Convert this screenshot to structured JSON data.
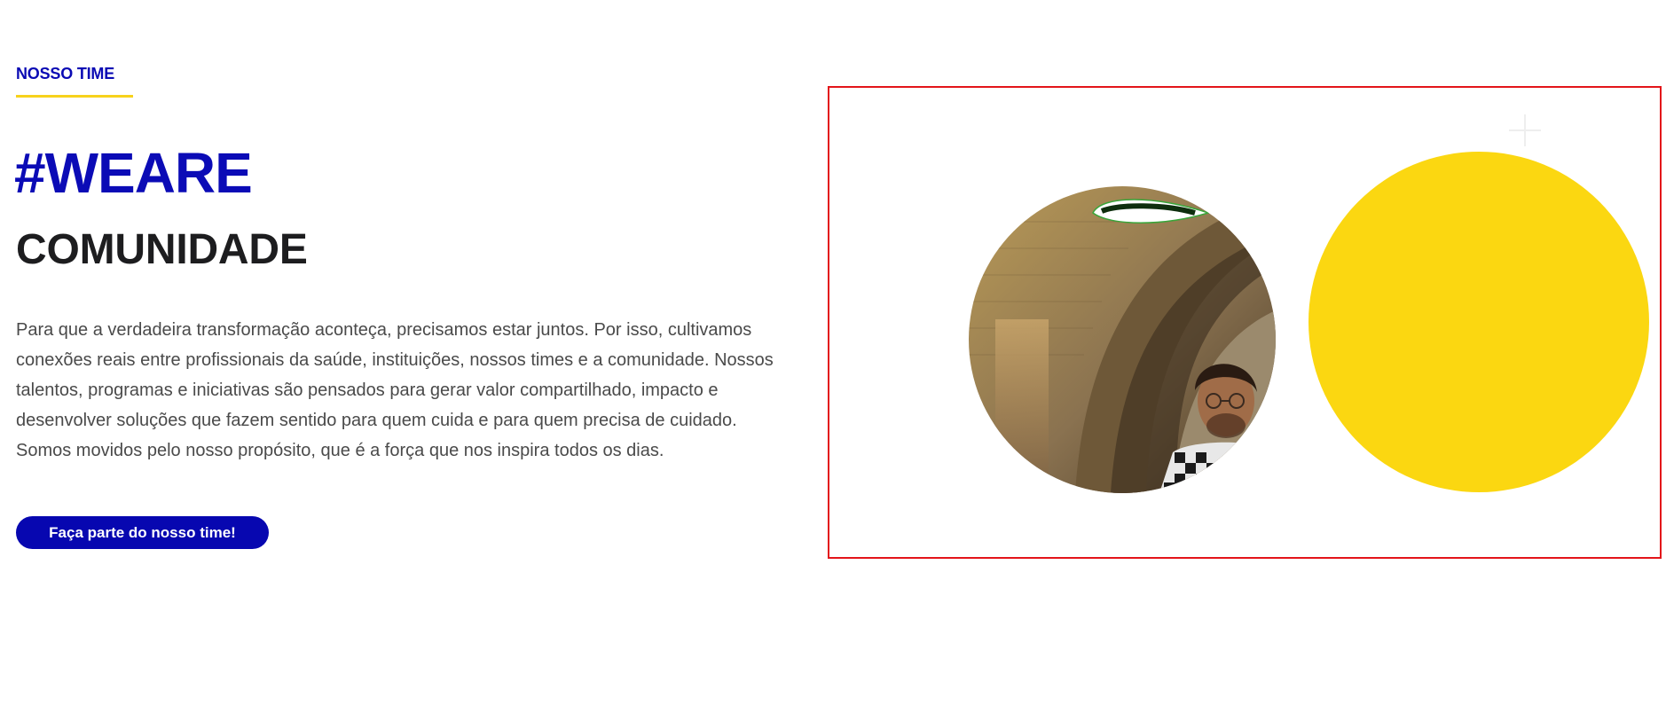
{
  "section": {
    "eyebrow": "NOSSO TIME",
    "hashtag": "#WEARE",
    "subtitle": "COMUNIDADE",
    "description": "Para que a verdadeira transformação aconteça, precisamos estar juntos. Por isso, cultivamos conexões reais entre profissionais da saúde, instituições, nossos times e a comunidade. Nossos talentos, programas e iniciativas são pensados para gerar valor compartilhado, impacto e desenvolver soluções que fazem sentido para quem cuida e para quem precisa de cuidado. Somos movidos pelo nosso propósito, que é a força que nos inspira todos os dias.",
    "cta_label": "Faça parte do nosso time!"
  },
  "visual": {
    "icons": {
      "plus": "plus-icon"
    }
  },
  "colors": {
    "brand_blue": "#0a0ab4",
    "accent_yellow": "#fbd711",
    "text_dark": "#1d1d1f",
    "text_body": "#4a4a4a",
    "highlight_red": "#e3151a"
  }
}
